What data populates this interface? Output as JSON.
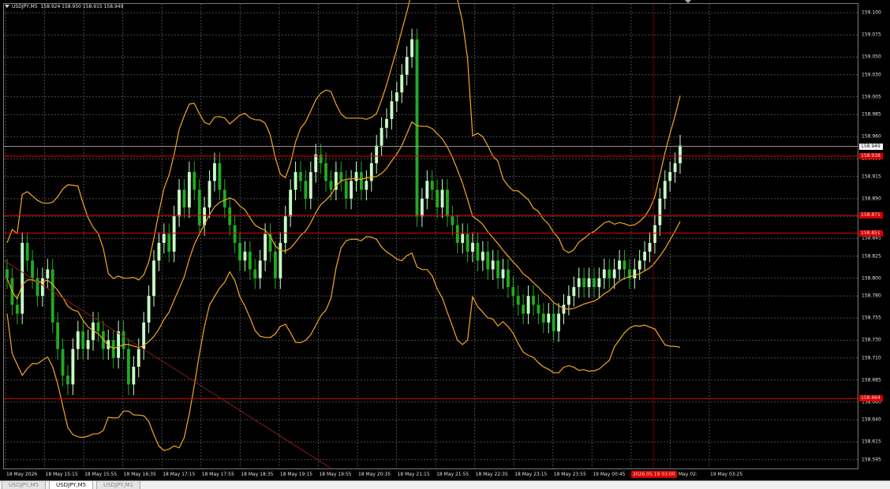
{
  "window": {
    "symbol_info": "USDJPY,M5  158.924 158.950 158.915 158.949",
    "current_price_label": "158.949",
    "level_labels": [
      "158.938",
      "158.871",
      "158.851",
      "158.664"
    ],
    "time_marker_label": "2026.05.19 03:00",
    "colors": {
      "background": "#000000",
      "grid": "#4a4a4a",
      "bull_candle": "#c8ffc8",
      "bear_candle": "#22aa22",
      "band": "#f5a623",
      "level_line": "#e00000",
      "trend_line": "#8b1a1a"
    }
  },
  "tabs": [
    {
      "label": "USDJPY,M5",
      "active": false
    },
    {
      "label": "USDJPY,M5",
      "active": true
    },
    {
      "label": "USDJPY,M1",
      "active": false
    }
  ],
  "chart_data": {
    "type": "candlestick",
    "ylim": [
      158.585,
      159.11
    ],
    "y_ticks": [
      "159.100",
      "159.075",
      "159.050",
      "159.030",
      "159.005",
      "158.985",
      "158.960",
      "158.935",
      "158.915",
      "158.890",
      "158.870",
      "158.845",
      "158.825",
      "158.800",
      "158.780",
      "158.755",
      "158.730",
      "158.710",
      "158.685",
      "158.660",
      "158.640",
      "158.615",
      "158.595"
    ],
    "x_ticks": [
      "18 May 2026",
      "18 May 15:15",
      "18 May 15:55",
      "18 May 16:35",
      "18 May 17:15",
      "18 May 17:55",
      "18 May 18:35",
      "18 May 19:15",
      "18 May 19:55",
      "18 May 20:35",
      "18 May 21:15",
      "18 May 21:55",
      "18 May 22:35",
      "18 May 23:15",
      "18 May 23:55",
      "19 May 00:45",
      "19 May 01:25",
      "19 May 02:",
      "19 May 03:25"
    ],
    "horizontal_levels": [
      158.938,
      158.871,
      158.851,
      158.664
    ],
    "current_price": 158.949,
    "close_series": [
      158.8,
      158.77,
      158.76,
      158.84,
      158.82,
      158.8,
      158.78,
      158.8,
      158.81,
      158.75,
      158.72,
      158.69,
      158.68,
      158.72,
      158.74,
      158.72,
      158.73,
      158.75,
      158.74,
      158.72,
      158.73,
      158.71,
      158.74,
      158.72,
      158.68,
      158.7,
      158.72,
      158.75,
      158.78,
      158.82,
      158.84,
      158.85,
      158.83,
      158.87,
      158.9,
      158.88,
      158.92,
      158.9,
      158.86,
      158.88,
      158.91,
      158.93,
      158.9,
      158.88,
      158.86,
      158.84,
      158.82,
      158.83,
      158.81,
      158.8,
      158.82,
      158.85,
      158.83,
      158.8,
      158.84,
      158.87,
      158.9,
      158.92,
      158.91,
      158.89,
      158.92,
      158.94,
      158.93,
      158.91,
      158.9,
      158.92,
      158.91,
      158.89,
      158.91,
      158.92,
      158.9,
      158.91,
      158.93,
      158.95,
      158.97,
      158.98,
      159.0,
      159.01,
      159.03,
      159.05,
      159.07,
      158.87,
      158.89,
      158.91,
      158.9,
      158.88,
      158.9,
      158.87,
      158.86,
      158.84,
      158.85,
      158.83,
      158.84,
      158.82,
      158.83,
      158.81,
      158.82,
      158.8,
      158.81,
      158.79,
      158.78,
      158.77,
      158.76,
      158.78,
      158.77,
      158.76,
      158.75,
      158.76,
      158.74,
      158.76,
      158.77,
      158.78,
      158.79,
      158.8,
      158.79,
      158.8,
      158.79,
      158.8,
      158.81,
      158.8,
      158.81,
      158.82,
      158.81,
      158.8,
      158.81,
      158.82,
      158.83,
      158.84,
      158.86,
      158.89,
      158.91,
      158.92,
      158.93,
      158.95
    ]
  }
}
